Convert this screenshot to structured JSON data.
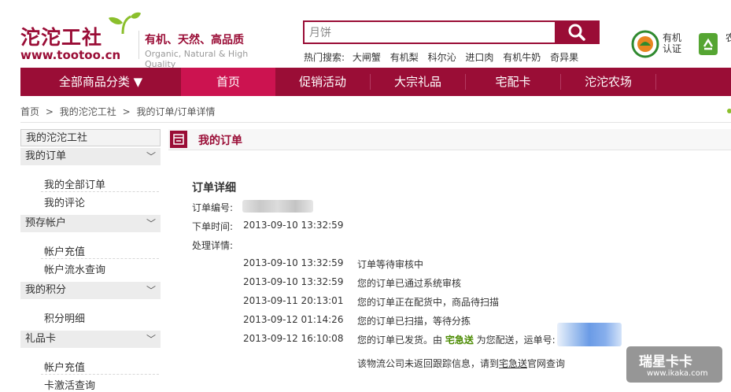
{
  "header": {
    "logo_cn": "沱沱工社",
    "logo_en": "www.tootoo.cn",
    "slogan": "有机、天然、高品质",
    "slogan_en": "Organic, Natural & High Quality",
    "search_value": "月饼",
    "hot_label": "热门搜索:",
    "hot_keywords": [
      "大闸蟹",
      "有机梨",
      "科尔沁",
      "进口肉",
      "有机牛奶",
      "奇异果"
    ],
    "badges": [
      {
        "icon": "organic-cert-icon",
        "label": "有机认证"
      },
      {
        "icon": "recycle-icon",
        "label": "农直"
      }
    ]
  },
  "nav": {
    "items": [
      "全部商品分类 ▼",
      "首页",
      "促销活动",
      "大宗礼品",
      "宅配卡",
      "沱沱农场"
    ],
    "active_index": 1
  },
  "breadcrumb": [
    "首页",
    "我的沱沱工社",
    "我的订单/订单详情"
  ],
  "breadcrumb_sep": ">",
  "sidebar": {
    "head": "我的沱沱工社",
    "sections": [
      {
        "title": "我的订单",
        "items": [
          "我的全部订单",
          "我的评论"
        ]
      },
      {
        "title": "预存帐户",
        "items": [
          "帐户充值",
          "帐户流水查询"
        ]
      },
      {
        "title": "我的积分",
        "items": [
          "积分明细"
        ]
      },
      {
        "title": "礼品卡",
        "items": [
          "帐户充值",
          "卡激活查询"
        ]
      }
    ],
    "chevron": "﹀"
  },
  "main": {
    "title": "我的订单",
    "detail_title": "订单详细",
    "order_no_label": "订单编号:",
    "order_time_label": "下单时间:",
    "order_time": "2013-09-10 13:32:59",
    "process_label": "处理详情:",
    "log": [
      {
        "time": "2013-09-10 13:32:59",
        "text": "订单等待审核中"
      },
      {
        "time": "2013-09-10 13:32:59",
        "text": "您的订单已通过系统审核"
      },
      {
        "time": "2013-09-11 20:13:01",
        "text": "您的订单正在配货中，商品待扫描"
      },
      {
        "time": "2013-09-12 01:14:26",
        "text": "您的订单已扫描，等待分拣"
      },
      {
        "time": "2013-09-12 16:10:08",
        "text_pre": "您的订单已发货。由 ",
        "courier": "宅急送",
        "text_post": " 为您配送，运单号:"
      }
    ],
    "note_pre": "该物流公司未返回跟踪信息，请到",
    "note_link": "宅急送",
    "note_post": "官网查询"
  },
  "watermark": {
    "cn": "瑞星卡卡",
    "en": "www.ikaka.com"
  },
  "colors": {
    "brand": "#9a0d36",
    "nav_active": "#cc1350",
    "green": "#4a8a00"
  }
}
